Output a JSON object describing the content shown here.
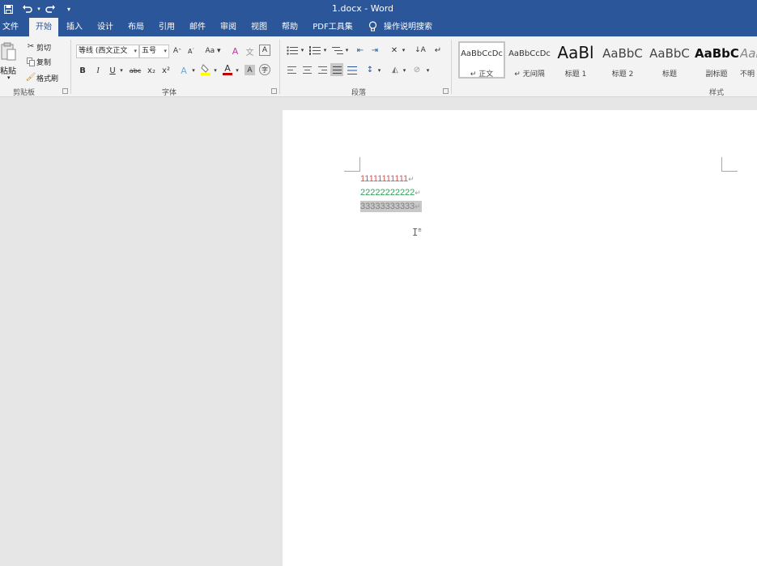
{
  "title_bar": {
    "title": "1.docx  -  Word",
    "quick_access": [
      "save-icon",
      "undo-icon",
      "redo-icon",
      "customize-icon"
    ]
  },
  "tabs": [
    {
      "label": "文件"
    },
    {
      "label": "开始",
      "active": true
    },
    {
      "label": "插入"
    },
    {
      "label": "设计"
    },
    {
      "label": "布局"
    },
    {
      "label": "引用"
    },
    {
      "label": "邮件"
    },
    {
      "label": "审阅"
    },
    {
      "label": "视图"
    },
    {
      "label": "帮助"
    },
    {
      "label": "PDF工具集"
    }
  ],
  "tell_me": "操作说明搜索",
  "clipboard": {
    "group": "剪贴板",
    "paste": "粘贴",
    "cut": "剪切",
    "copy": "复制",
    "format_painter": "格式刷"
  },
  "font": {
    "group": "字体",
    "font_name": "等线 (西文正文",
    "font_size": "五号",
    "grow": "A",
    "shrink": "A",
    "case": "Aa",
    "bold": "B",
    "italic": "I",
    "underline": "U",
    "strike": "abc",
    "subscript": "x₂",
    "superscript": "x²",
    "font_color": "A",
    "char_shade": "A",
    "highlight_color": "#ffff00",
    "font_color_value": "#c00000"
  },
  "paragraph": {
    "group": "段落"
  },
  "styles": {
    "group": "样式",
    "items": [
      {
        "sample": "AaBbCcDc",
        "name": "↵ 正文",
        "selected": true
      },
      {
        "sample": "AaBbCcDc",
        "name": "↵ 无间隔"
      },
      {
        "sample": "AaBl",
        "name": "标题 1"
      },
      {
        "sample": "AaBbC",
        "name": "标题 2"
      },
      {
        "sample": "AaBbC",
        "name": "标题"
      },
      {
        "sample": "AaBbC",
        "name": "副标题"
      },
      {
        "sample": "AaBl",
        "name": "不明"
      }
    ]
  },
  "document": {
    "lines": [
      {
        "text": "11111111111",
        "color": "#d9534f",
        "mark": "↵"
      },
      {
        "text": "22222222222",
        "color": "#3a9b5c",
        "mark": "↵"
      },
      {
        "text": "33333333333",
        "color": "#808080",
        "mark": "↵",
        "highlight": "#c8c8c8"
      }
    ]
  }
}
